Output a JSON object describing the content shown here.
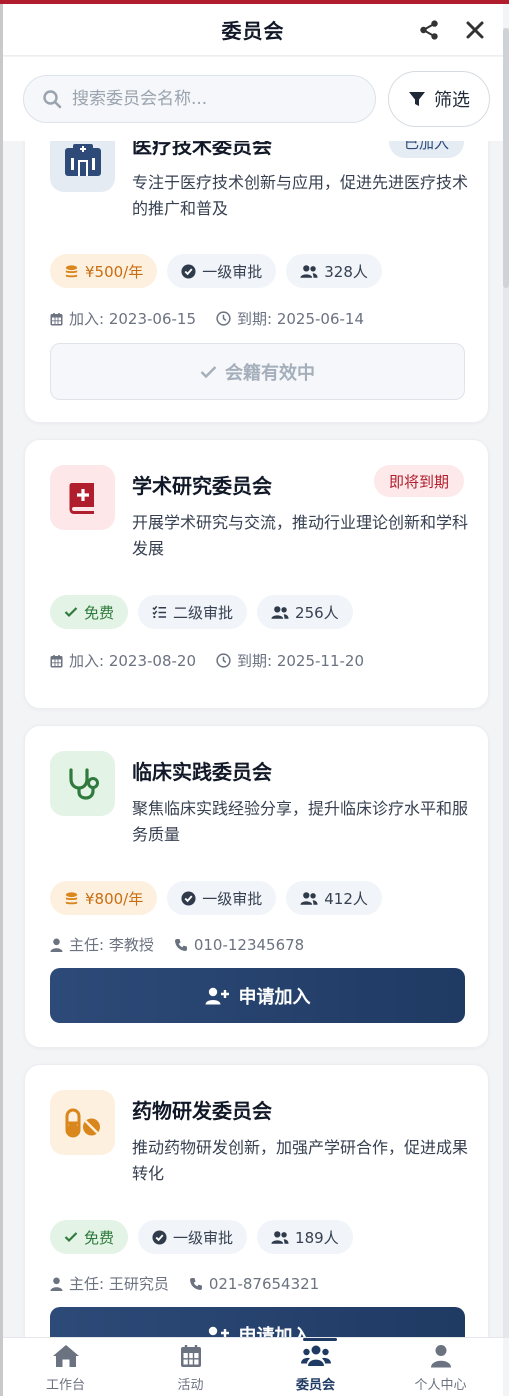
{
  "header": {
    "title": "委员会"
  },
  "search": {
    "placeholder": "搜索委员会名称...",
    "filter_label": "筛选"
  },
  "committees": [
    {
      "title": "医疗技术委员会",
      "status": "已加入",
      "description": "专注于医疗技术创新与应用，促进先进医疗技术的推广和普及",
      "fee": "¥500/年",
      "approval": "一级审批",
      "members": "328人",
      "join_date": "加入: 2023-06-15",
      "expire_date": "到期: 2025-06-14",
      "action": "会籍有效中"
    },
    {
      "title": "学术研究委员会",
      "status": "即将到期",
      "description": "开展学术研究与交流，推动行业理论创新和学科发展",
      "fee": "免费",
      "approval": "二级审批",
      "members": "256人",
      "join_date": "加入: 2023-08-20",
      "expire_date": "到期: 2025-11-20"
    },
    {
      "title": "临床实践委员会",
      "description": "聚焦临床实践经验分享，提升临床诊疗水平和服务质量",
      "fee": "¥800/年",
      "approval": "一级审批",
      "members": "412人",
      "director": "主任: 李教授",
      "phone": "010-12345678",
      "action": "申请加入"
    },
    {
      "title": "药物研发委员会",
      "description": "推动药物研发创新，加强产学研合作，促进成果转化",
      "fee": "免费",
      "approval": "一级审批",
      "members": "189人",
      "director": "主任: 王研究员",
      "phone": "021-87654321",
      "action": "申请加入"
    }
  ],
  "nav": [
    {
      "label": "工作台",
      "icon": "home-icon"
    },
    {
      "label": "活动",
      "icon": "calendar-icon"
    },
    {
      "label": "委员会",
      "icon": "users-icon",
      "active": true
    },
    {
      "label": "个人中心",
      "icon": "user-icon"
    }
  ],
  "colors": {
    "primary": "#1f3a63",
    "accent_red": "#b01e2d",
    "fee": "#c96d12",
    "free": "#2f7a3c"
  }
}
